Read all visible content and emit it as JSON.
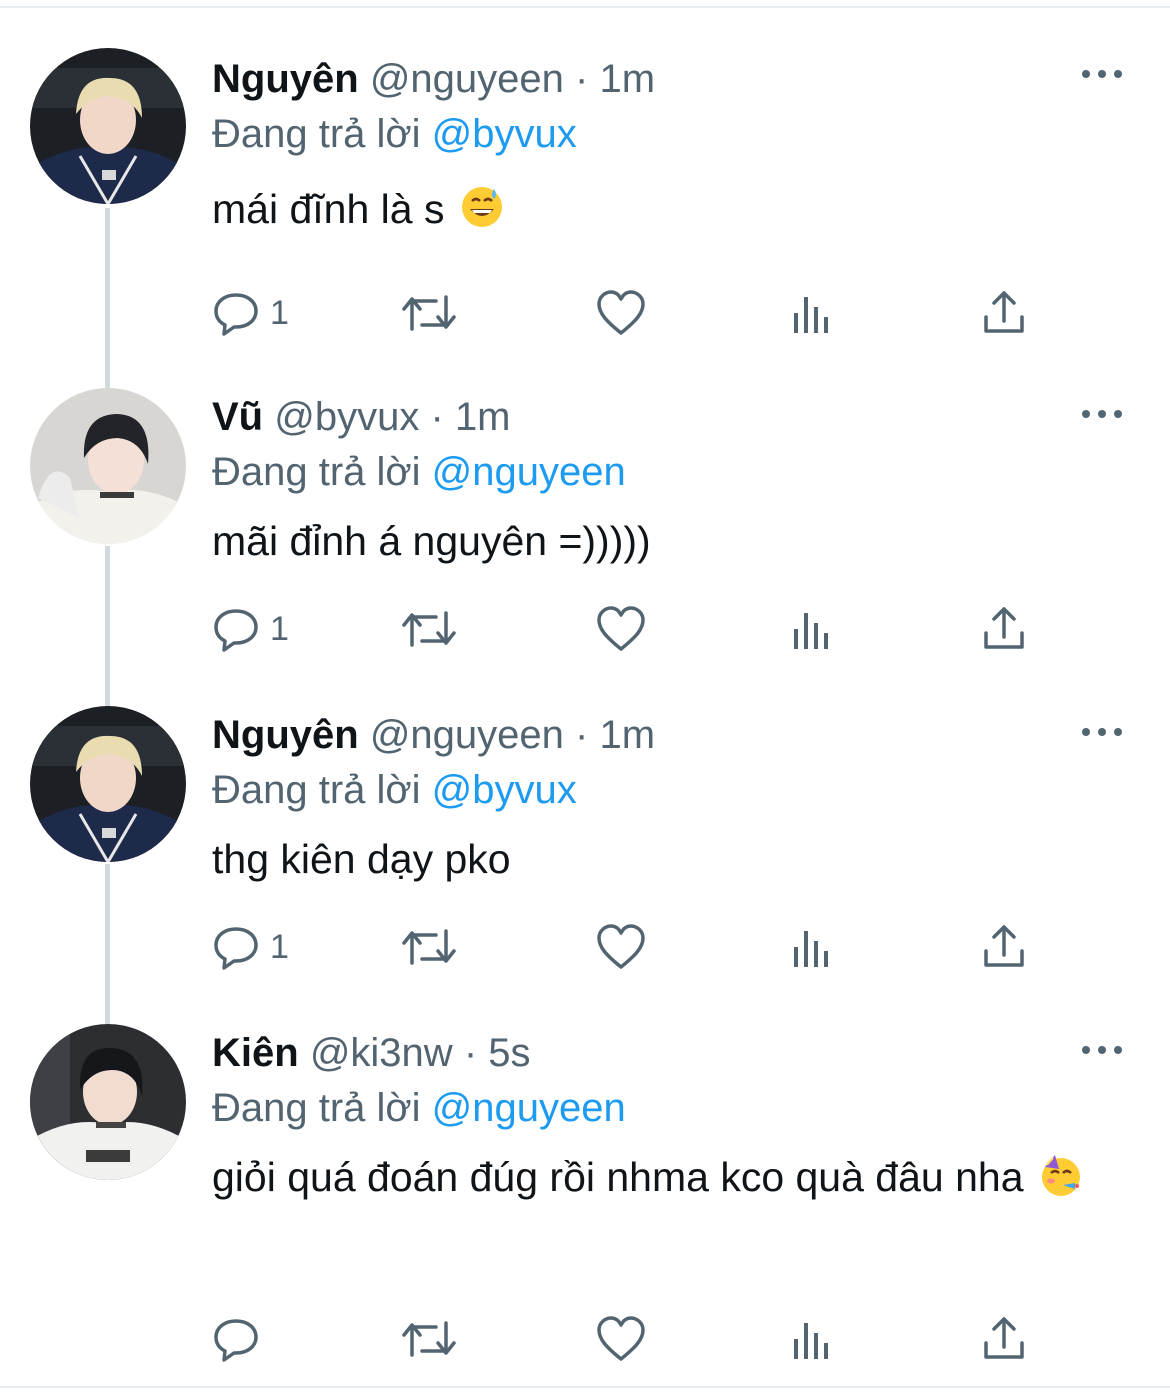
{
  "tweets": [
    {
      "name": "Nguyên",
      "handle": "@nguyeen",
      "dot": "·",
      "time": "1m",
      "reply_prefix": "Đang trả lời",
      "reply_to": "@byvux",
      "text": "mái đĩnh là s",
      "emoji": "grinning-face-with-sweat-icon",
      "reply_count": "1"
    },
    {
      "name": "Vũ",
      "handle": "@byvux",
      "dot": "·",
      "time": "1m",
      "reply_prefix": "Đang trả lời",
      "reply_to": "@nguyeen",
      "text": "mãi đỉnh á nguyên =)))))",
      "reply_count": "1"
    },
    {
      "name": "Nguyên",
      "handle": "@nguyeen",
      "dot": "·",
      "time": "1m",
      "reply_prefix": "Đang trả lời",
      "reply_to": "@byvux",
      "text": "thg kiên dạy pko",
      "reply_count": "1"
    },
    {
      "name": "Kiên",
      "handle": "@ki3nw",
      "dot": "·",
      "time": "5s",
      "reply_prefix": "Đang trả lời",
      "reply_to": "@nguyeen",
      "text": "giỏi quá đoán đúg rồi nhma kco quà đâu nha",
      "emoji": "partying-face-icon",
      "reply_count": ""
    }
  ],
  "colors": {
    "text": "#0f1419",
    "secondary": "#536471",
    "accent": "#1d9bf0",
    "thread_line": "#cfd9de"
  }
}
